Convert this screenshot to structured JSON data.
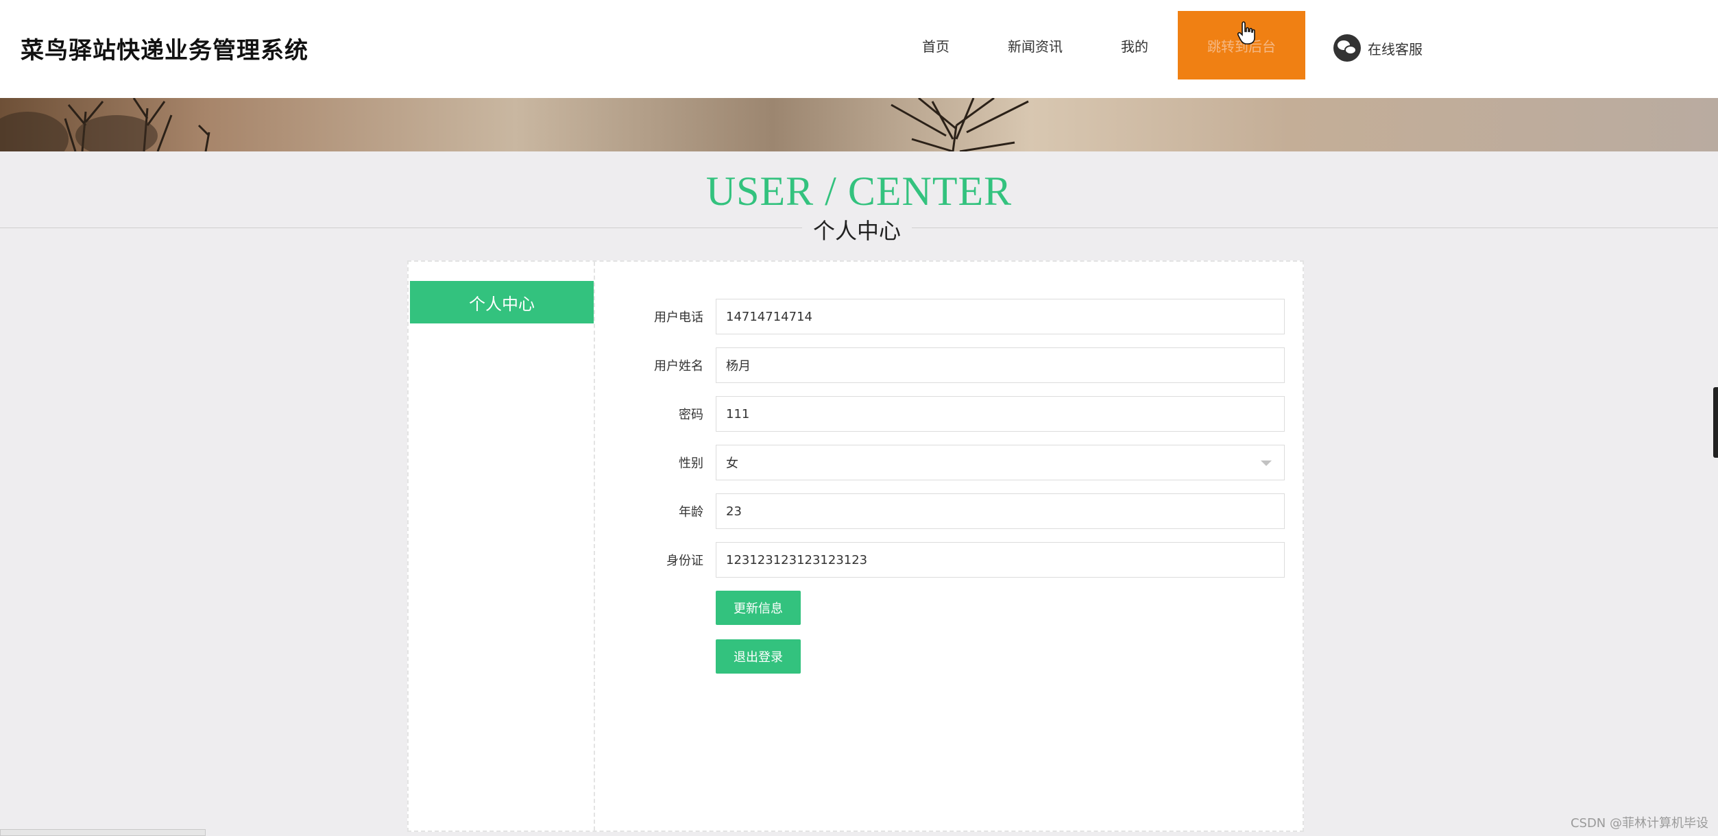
{
  "header": {
    "logo": "菜鸟驿站快递业务管理系统",
    "nav": {
      "home": "首页",
      "news": "新闻资讯",
      "mine": "我的",
      "admin": "跳转到后台",
      "service": "在线客服"
    }
  },
  "section": {
    "title": "USER / CENTER",
    "subtitle": "个人中心"
  },
  "sidebar": {
    "items": [
      {
        "label": "个人中心"
      }
    ]
  },
  "form": {
    "fields": [
      {
        "label": "用户电话",
        "value": "14714714714"
      },
      {
        "label": "用户姓名",
        "value": "杨月"
      },
      {
        "label": "密码",
        "value": "111"
      },
      {
        "label": "性别",
        "value": "女"
      },
      {
        "label": "年龄",
        "value": "23"
      },
      {
        "label": "身份证",
        "value": "123123123123123123"
      }
    ],
    "update_button": "更新信息",
    "logout_button": "退出登录"
  },
  "watermark": "CSDN @菲林计算机毕设",
  "colors": {
    "accent": "#33c27e",
    "admin_nav": "#f08013"
  }
}
